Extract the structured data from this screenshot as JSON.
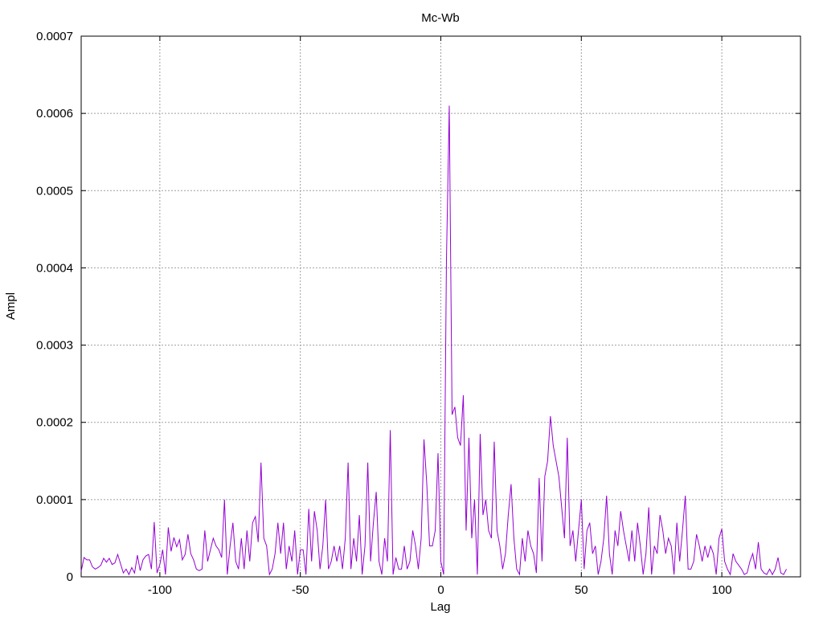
{
  "chart_data": {
    "type": "line",
    "title": "Mc-Wb",
    "xlabel": "Lag",
    "ylabel": "Ampl",
    "xlim": [
      -128,
      128
    ],
    "ylim": [
      0,
      0.0007
    ],
    "grid": true,
    "x_ticks": [
      -100,
      -50,
      0,
      50,
      100
    ],
    "x_tick_labels": [
      "-100",
      "-50",
      "0",
      "50",
      "100"
    ],
    "y_ticks": [
      0,
      0.0001,
      0.0002,
      0.0003,
      0.0004,
      0.0005,
      0.0006,
      0.0007
    ],
    "y_tick_labels": [
      "0",
      "0.0001",
      "0.0002",
      "0.0003",
      "0.0004",
      "0.0005",
      "0.0006",
      "0.0007"
    ],
    "line_color": "#9400d3",
    "series": [
      {
        "x_start": -128,
        "x_step": 1,
        "values": [
          7e-06,
          2.5e-05,
          2.2e-05,
          2.2e-05,
          1.3e-05,
          1e-05,
          1.2e-05,
          1.5e-05,
          2.4e-05,
          1.9e-05,
          2.4e-05,
          1.6e-05,
          1.8e-05,
          2.9e-05,
          1.7e-05,
          5e-06,
          1e-05,
          3e-06,
          1.2e-05,
          5e-06,
          2.8e-05,
          8e-06,
          2.2e-05,
          2.7e-05,
          2.9e-05,
          1e-05,
          7.1e-05,
          5e-06,
          1.6e-05,
          3.5e-05,
          3e-06,
          6.4e-05,
          3.3e-05,
          5.1e-05,
          3.9e-05,
          4.8e-05,
          2.2e-05,
          2.9e-05,
          5.5e-05,
          3e-05,
          2.2e-05,
          1e-05,
          8e-06,
          1e-05,
          6e-05,
          2e-05,
          3.5e-05,
          5e-05,
          4e-05,
          3.5e-05,
          2.5e-05,
          0.0001,
          3e-06,
          4e-05,
          7e-05,
          2e-05,
          1e-05,
          5e-05,
          1e-05,
          6e-05,
          2e-05,
          7e-05,
          7.8e-05,
          4.5e-05,
          0.000148,
          5e-05,
          4e-05,
          3e-06,
          1e-05,
          3e-05,
          7e-05,
          3e-05,
          7e-05,
          1e-05,
          4e-05,
          2e-05,
          6e-05,
          3e-06,
          3.5e-05,
          3.5e-05,
          3e-06,
          8.8e-05,
          2e-05,
          8.5e-05,
          6e-05,
          1e-05,
          4e-05,
          0.0001,
          1e-05,
          2e-05,
          4e-05,
          2e-05,
          4e-05,
          1e-05,
          5e-05,
          0.000148,
          1e-05,
          5e-05,
          2e-05,
          8e-05,
          3e-06,
          4e-05,
          0.000148,
          2e-05,
          7e-05,
          0.00011,
          2e-05,
          3e-06,
          5e-05,
          2e-05,
          0.00019,
          3e-06,
          2.5e-05,
          1e-05,
          1e-05,
          4e-05,
          1e-05,
          2e-05,
          6e-05,
          4e-05,
          1e-05,
          5e-05,
          0.000178,
          0.00012,
          4e-05,
          4e-05,
          6e-05,
          0.00016,
          2e-05,
          3e-06,
          0.00041,
          0.00061,
          0.00021,
          0.00022,
          0.00018,
          0.00017,
          0.000235,
          6e-05,
          0.00018,
          5e-05,
          0.0001,
          3e-06,
          0.000185,
          8e-05,
          0.0001,
          6e-05,
          5e-05,
          0.000175,
          6e-05,
          4e-05,
          1e-05,
          3e-05,
          8e-05,
          0.00012,
          5e-05,
          1e-05,
          3e-06,
          5e-05,
          2e-05,
          6e-05,
          4e-05,
          3e-05,
          5e-06,
          0.000128,
          2e-05,
          0.00013,
          0.00015,
          0.000208,
          0.00017,
          0.00015,
          0.00013,
          9e-05,
          5e-05,
          0.00018,
          4e-05,
          6e-05,
          2e-05,
          6e-05,
          0.0001,
          1e-05,
          6e-05,
          7e-05,
          3e-05,
          4e-05,
          3e-06,
          2e-05,
          5e-05,
          0.000105,
          3e-05,
          3e-06,
          6e-05,
          4e-05,
          8.5e-05,
          6e-05,
          4e-05,
          2e-05,
          6e-05,
          2e-05,
          7e-05,
          4e-05,
          3e-06,
          3e-05,
          9e-05,
          3e-06,
          4e-05,
          3e-05,
          8e-05,
          6e-05,
          3e-05,
          5e-05,
          4e-05,
          3e-06,
          7e-05,
          2e-05,
          6e-05,
          0.000105,
          1e-05,
          1e-05,
          2e-05,
          5.5e-05,
          4e-05,
          2e-05,
          4e-05,
          2.5e-05,
          4e-05,
          3e-05,
          3e-06,
          5e-05,
          6.2e-05,
          2e-05,
          1e-05,
          3e-06,
          3e-05,
          2e-05,
          1.5e-05,
          1e-05,
          3e-06,
          5e-06,
          2e-05,
          3e-05,
          1e-05,
          4.5e-05,
          1e-05,
          5e-06,
          3e-06,
          1e-05,
          3e-06,
          1e-05,
          2.5e-05,
          5e-06,
          3e-06,
          1e-05
        ]
      }
    ]
  }
}
